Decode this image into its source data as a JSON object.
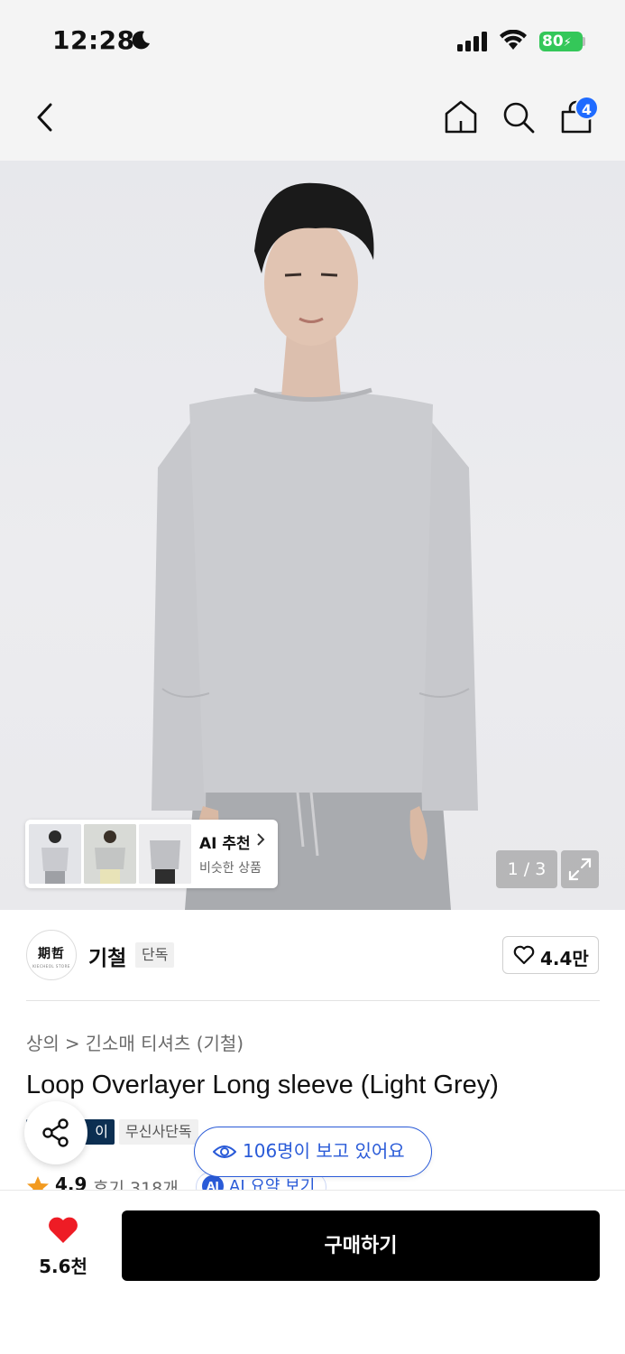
{
  "status_bar": {
    "time": "12:28",
    "battery": "80"
  },
  "nav": {
    "cart_count": "4"
  },
  "hero": {
    "ai_card": {
      "title": "AI 추천",
      "subtitle": "비슷한 상품"
    },
    "page_indicator": "1 / 3"
  },
  "brand": {
    "logo_text": "期哲",
    "logo_sub": "KIECHEOL STORE",
    "name": "기철",
    "tag": "단독",
    "like_count": "4.4만"
  },
  "breadcrumb": {
    "level1": "상의",
    "separator": ">",
    "level2": "긴소매 티셔츠 (기철)"
  },
  "product": {
    "title": "Loop Overlayer Long sleeve (Light Grey)",
    "tag_dark": "이",
    "tag_light": "무신사단독",
    "rating": "4.9",
    "reviews": "후기 318개",
    "ai_summary_badge": "AI",
    "ai_summary": "AI 요약 보기"
  },
  "viewers": {
    "text": "106명이 보고 있어요"
  },
  "bottom": {
    "wish_count": "5.6천",
    "buy_label": "구매하기"
  },
  "colors": {
    "accent_blue": "#2a5bd8",
    "heart_red": "#ee1c25",
    "buy_bg": "#000000",
    "tag_dark": "#0c2f52"
  }
}
